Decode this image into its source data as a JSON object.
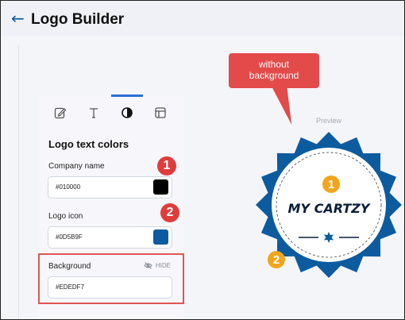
{
  "header": {
    "title": "Logo Builder",
    "back_icon": "arrow-left-icon"
  },
  "callout": {
    "line1": "without",
    "line2": "background",
    "color": "#e34a4a"
  },
  "preview": {
    "label": "Preview"
  },
  "tabs": [
    {
      "icon": "edit-icon",
      "active": false
    },
    {
      "icon": "text-icon",
      "active": false
    },
    {
      "icon": "contrast-icon",
      "active": true
    },
    {
      "icon": "layout-icon",
      "active": false
    }
  ],
  "panel": {
    "title": "Logo text colors",
    "company": {
      "label": "Company name",
      "value": "#010000",
      "color": "#010000"
    },
    "icon": {
      "label": "Logo icon",
      "value": "#0D5B9F",
      "color": "#0D5B9F"
    },
    "background": {
      "label": "Background",
      "value": "#EDEDF7",
      "hide_label": "HIDE"
    }
  },
  "badges": {
    "red1": "1",
    "red2": "2",
    "yellow1": "1",
    "yellow2": "2",
    "red_color": "#e03c3c",
    "yellow_color": "#f2a51c"
  },
  "logo": {
    "text": "MY CARTZY",
    "primary_color": "#0d5b9f",
    "ring_color": "#ffffff",
    "text_color": "#0b1f3a"
  }
}
